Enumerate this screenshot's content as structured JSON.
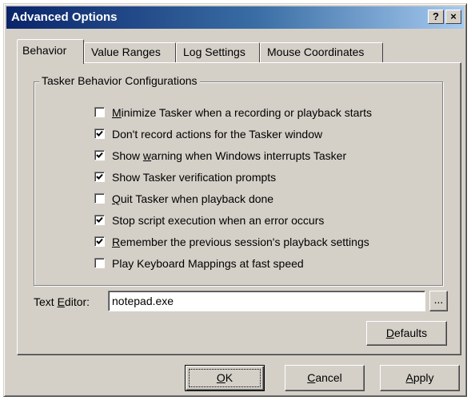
{
  "window": {
    "title": "Advanced Options",
    "help_button": "?",
    "close_button": "×"
  },
  "tabs": [
    {
      "label": "Behavior",
      "active": true
    },
    {
      "label": "Value Ranges",
      "active": false
    },
    {
      "label": "Log Settings",
      "active": false
    },
    {
      "label": "Mouse Coordinates",
      "active": false
    }
  ],
  "group": {
    "legend": "Tasker Behavior Configurations",
    "options": [
      {
        "mnemonic": "M",
        "rest": "inimize Tasker when a recording or playback starts",
        "checked": false
      },
      {
        "mnemonic": "",
        "rest": "Don't record actions for the Tasker window",
        "checked": true
      },
      {
        "pre": "Show ",
        "mnemonic": "w",
        "rest": "arning when Windows interrupts Tasker",
        "checked": true
      },
      {
        "mnemonic": "",
        "rest": "Show Tasker verification prompts",
        "checked": true
      },
      {
        "mnemonic": "Q",
        "rest": "uit Tasker when playback done",
        "checked": false
      },
      {
        "mnemonic": "",
        "rest": "Stop script execution when an error occurs",
        "checked": true
      },
      {
        "mnemonic": "R",
        "rest": "emember the previous session's playback settings",
        "checked": true
      },
      {
        "mnemonic": "",
        "rest": "Play Keyboard Mappings at fast speed",
        "checked": false
      }
    ]
  },
  "text_editor": {
    "label_pre": "Text ",
    "label_mnemonic": "E",
    "label_rest": "ditor:",
    "value": "notepad.exe",
    "browse_label": "..."
  },
  "defaults_button": {
    "mnemonic": "D",
    "rest": "efaults"
  },
  "footer": {
    "ok": {
      "mnemonic": "O",
      "rest": "K"
    },
    "cancel": {
      "mnemonic": "C",
      "rest": "ancel"
    },
    "apply": {
      "mnemonic": "A",
      "rest": "pply"
    }
  },
  "colors": {
    "face": "#d4d0c8",
    "titlebar_start": "#0a246a",
    "titlebar_end": "#a6caf0",
    "title_text": "#ffffff"
  },
  "icons": {
    "check": "checkmark-icon",
    "help": "help-icon",
    "close": "close-icon"
  }
}
